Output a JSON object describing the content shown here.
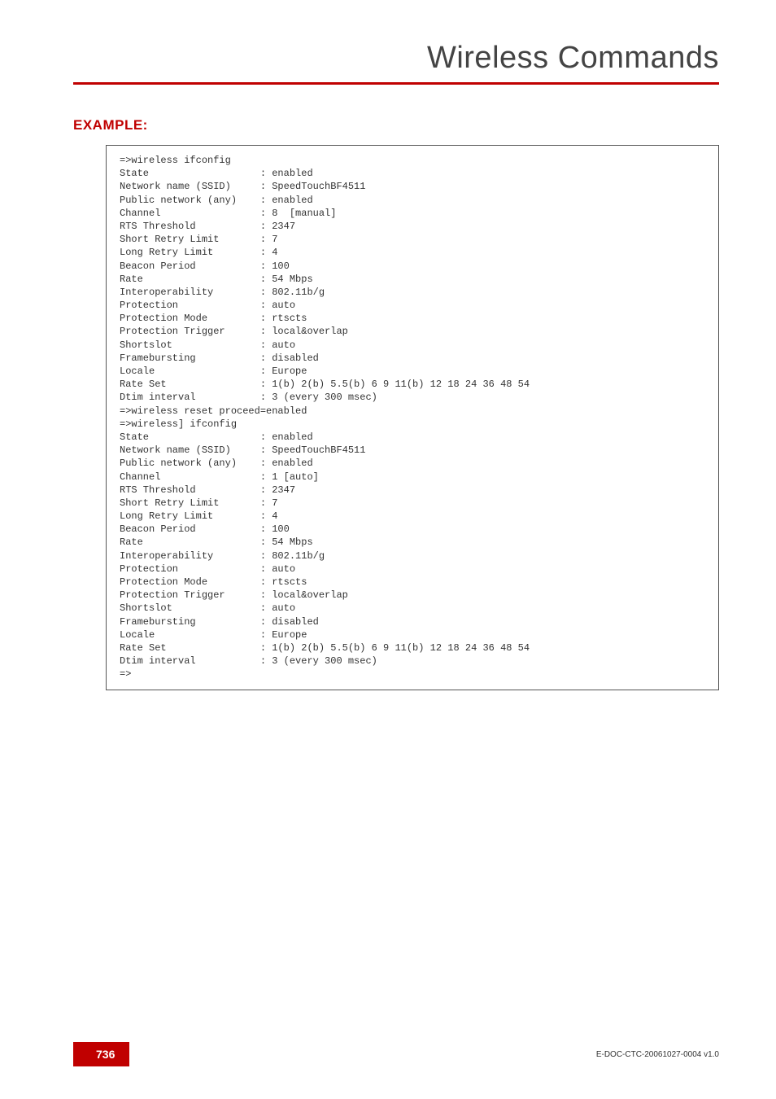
{
  "header": {
    "title": "Wireless Commands"
  },
  "section": {
    "example_label": "EXAMPLE:"
  },
  "code": {
    "lines": [
      "=>wireless ifconfig",
      "State                   : enabled",
      "Network name (SSID)     : SpeedTouchBF4511",
      "Public network (any)    : enabled",
      "Channel                 : 8  [manual]",
      "RTS Threshold           : 2347",
      "Short Retry Limit       : 7",
      "Long Retry Limit        : 4",
      "Beacon Period           : 100",
      "Rate                    : 54 Mbps",
      "Interoperability        : 802.11b/g",
      "Protection              : auto",
      "Protection Mode         : rtscts",
      "Protection Trigger      : local&overlap",
      "Shortslot               : auto",
      "Framebursting           : disabled",
      "Locale                  : Europe",
      "Rate Set                : 1(b) 2(b) 5.5(b) 6 9 11(b) 12 18 24 36 48 54",
      "Dtim interval           : 3 (every 300 msec)",
      "=>wireless reset proceed=enabled",
      "=>wireless] ifconfig",
      "State                   : enabled",
      "Network name (SSID)     : SpeedTouchBF4511",
      "Public network (any)    : enabled",
      "Channel                 : 1 [auto]",
      "RTS Threshold           : 2347",
      "Short Retry Limit       : 7",
      "Long Retry Limit        : 4",
      "Beacon Period           : 100",
      "Rate                    : 54 Mbps",
      "Interoperability        : 802.11b/g",
      "Protection              : auto",
      "Protection Mode         : rtscts",
      "Protection Trigger      : local&overlap",
      "Shortslot               : auto",
      "Framebursting           : disabled",
      "Locale                  : Europe",
      "Rate Set                : 1(b) 2(b) 5.5(b) 6 9 11(b) 12 18 24 36 48 54",
      "Dtim interval           : 3 (every 300 msec)",
      "=>"
    ]
  },
  "footer": {
    "page_number": "736",
    "doc_id": "E-DOC-CTC-20061027-0004 v1.0"
  }
}
